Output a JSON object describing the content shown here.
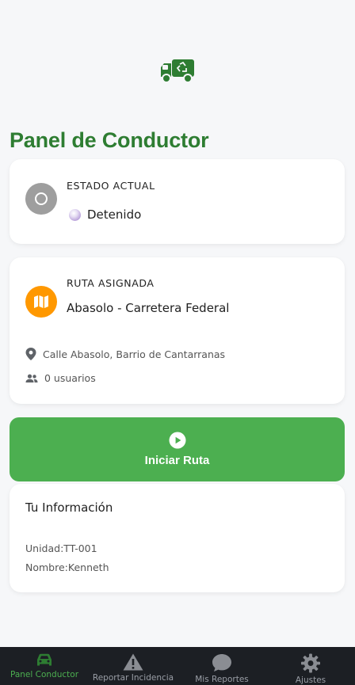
{
  "header": {
    "logo_icon": "recycling-truck-icon"
  },
  "page": {
    "title": "Panel de Conductor"
  },
  "status_card": {
    "caption": "ESTADO ACTUAL",
    "icon": "circle-outline-icon",
    "value_icon": "pearl-orb-icon",
    "value": "Detenido"
  },
  "route_card": {
    "caption": "RUTA ASIGNADA",
    "icon": "map-icon",
    "name": "Abasolo - Carretera Federal",
    "address_icon": "location-pin-icon",
    "address": "Calle Abasolo, Barrio de Cantarranas",
    "users_icon": "users-icon",
    "users": "0 usuarios"
  },
  "action": {
    "start_icon": "play-circle-icon",
    "start_label": "Iniciar Ruta"
  },
  "info_card": {
    "title": "Tu Información",
    "unit": "Unidad:TT-001",
    "name": "Nombre:Kenneth"
  },
  "bottom_nav": {
    "items": [
      {
        "label": "Panel Conductor",
        "icon": "car-icon",
        "active": true
      },
      {
        "label": "Reportar Incidencia",
        "icon": "warning-icon",
        "active": false
      },
      {
        "label": "Mis Reportes",
        "icon": "chat-bubble-icon",
        "active": false
      },
      {
        "label": "Ajustes",
        "icon": "gear-icon",
        "active": false
      }
    ]
  },
  "colors": {
    "brand_green": "#2e7d32",
    "action_green": "#4caf50",
    "route_orange": "#ff9800",
    "status_gray": "#9e9e9e",
    "nav_bg": "#1c1f24"
  }
}
